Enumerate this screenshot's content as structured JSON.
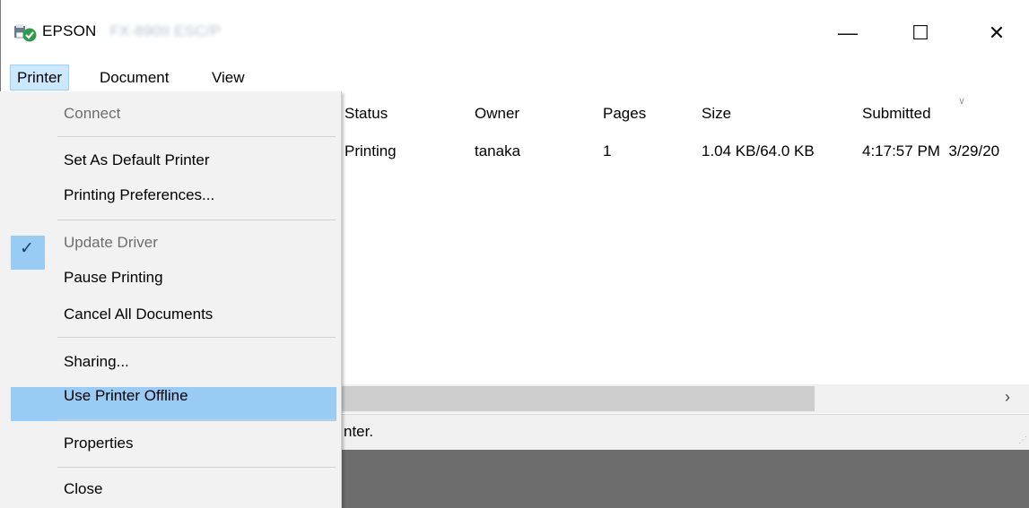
{
  "window": {
    "title_brand": "EPSON",
    "title_model": "FX-890II ESC/P",
    "controls": {
      "minimize": "—",
      "maximize": "☐",
      "close": "✕"
    }
  },
  "menubar": {
    "printer": "Printer",
    "document": "Document",
    "view": "View"
  },
  "columns": {
    "status": "Status",
    "owner": "Owner",
    "pages": "Pages",
    "size": "Size",
    "submitted": "Submitted"
  },
  "job": {
    "status": "Printing",
    "owner": "tanaka",
    "pages": "1",
    "size": "1.04 KB/64.0 KB",
    "submitted": "4:17:57 PM  3/29/20"
  },
  "statusbar": {
    "text": "nter."
  },
  "printer_menu": {
    "items": [
      {
        "label": "Connect",
        "enabled": false
      },
      {
        "label": "Set As Default Printer",
        "checked": true
      },
      {
        "label": "Printing Preferences..."
      },
      {
        "label": "Update Driver",
        "enabled": false
      },
      {
        "label": "Pause Printing"
      },
      {
        "label": "Cancel All Documents",
        "highlighted": true
      },
      {
        "label": "Sharing..."
      },
      {
        "label": "Use Printer Offline"
      },
      {
        "label": "Properties"
      },
      {
        "label": "Close"
      }
    ]
  },
  "colors": {
    "highlight": "#99ccf5",
    "menu_active": "#cce8ff",
    "desktop": "#6d6d6d"
  }
}
